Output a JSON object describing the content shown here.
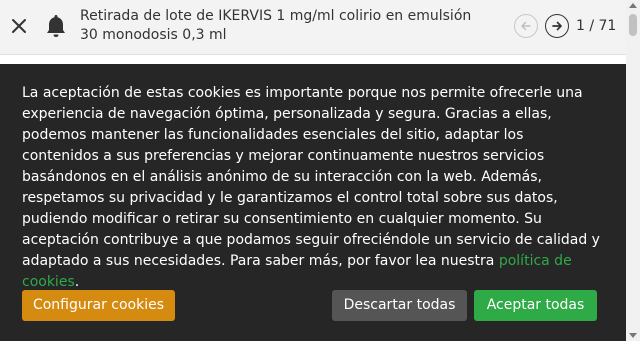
{
  "notification": {
    "text": "Retirada de lote de IKERVIS 1 mg/ml colirio en emulsión 30 monodosis 0,3 ml",
    "counter": "1 / 71",
    "icons": {
      "close": "close-icon",
      "bell": "bell-icon",
      "prev": "arrow-left-icon",
      "next": "arrow-right-icon"
    }
  },
  "cookie_banner": {
    "text": "La aceptación de estas cookies es importante porque nos permite ofrecerle una experiencia de navegación óptima, personalizada y segura. Gracias a ellas, podemos mantener las funcionalidades esenciales del sitio, adaptar los contenidos a sus preferencias y mejorar continuamente nuestros servicios basándonos en el análisis anónimo de su interacción con la web. Además, respetamos su privacidad y le garantizamos el control total sobre sus datos, pudiendo modificar o retirar su consentimiento en cualquier momento. Su aceptación contribuye a que podamos seguir ofreciéndole un servicio de calidad y adaptado a sus necesidades. Para saber más, por favor lea nuestra",
    "link_text": "política de cookies",
    "link_suffix": ".",
    "buttons": {
      "configure": "Configurar cookies",
      "discard": "Descartar todas",
      "accept": "Aceptar todas"
    },
    "colors": {
      "background": "#262626",
      "configure": "#d58a10",
      "discard": "#555555",
      "accept": "#2eaa47",
      "link": "#2eaa47"
    }
  }
}
